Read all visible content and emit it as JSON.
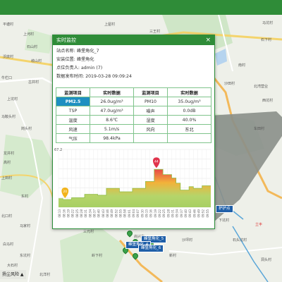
{
  "dialog": {
    "title": "实时监控",
    "close_glyph": "×",
    "info": [
      {
        "label": "站点名称:",
        "value": "峰堡角化_7"
      },
      {
        "label": "安装位置:",
        "value": "峰堡角化"
      },
      {
        "label": "点位负责人:",
        "value": "admin (7)"
      },
      {
        "label": "数据发布时间:",
        "value": "2019-03-28 09:09:24"
      }
    ],
    "table_headers": [
      "监测项目",
      "实时数据",
      "监测项目",
      "实时数据"
    ],
    "rows": [
      [
        "PM2.5",
        "26.0ug/m³",
        "PM10",
        "35.0ug/m³"
      ],
      [
        "TSP",
        "47.0ug/m³",
        "噪声",
        "0.0dB"
      ],
      [
        "温度",
        "8.6℃",
        "湿度",
        "40.0%"
      ],
      [
        "风速",
        "5.1m/s",
        "风向",
        "东北"
      ],
      [
        "气压",
        "98.4kPa",
        "",
        ""
      ]
    ]
  },
  "chart_data": {
    "type": "area",
    "ylim": [
      0,
      67.2
    ],
    "y_max_label": "67.2",
    "x": [
      "08:13",
      "08:16",
      "08:19",
      "08:22",
      "08:25",
      "08:28",
      "08:31",
      "08:34",
      "08:37",
      "08:40",
      "08:43",
      "08:46",
      "08:49",
      "08:52",
      "08:55",
      "08:58",
      "09:01",
      "09:04",
      "09:07",
      "09:10",
      "09:13",
      "09:16",
      "09:19",
      "09:22",
      "09:25",
      "09:28",
      "09:31",
      "09:34",
      "09:37",
      "09:40",
      "09:43",
      "09:46",
      "09:49",
      "09:52",
      "09:55"
    ],
    "values": [
      10,
      9,
      9,
      11,
      11,
      11,
      15,
      15,
      15,
      14,
      14,
      22,
      22,
      22,
      18,
      18,
      18,
      22,
      22,
      22,
      30,
      30,
      44,
      44,
      38,
      38,
      34,
      28,
      20,
      20,
      24,
      22,
      22,
      25,
      25
    ],
    "markers": [
      {
        "index": 1,
        "label": "20",
        "color": "#f2b31a"
      },
      {
        "index": 22,
        "label": "44",
        "color": "#e0324b"
      }
    ]
  },
  "map": {
    "labels": [
      {
        "text": "平塘村",
        "cls": ""
      },
      {
        "text": "上河村",
        "cls": ""
      },
      {
        "text": "石山村",
        "cls": ""
      },
      {
        "text": "沃底村",
        "cls": ""
      },
      {
        "text": "岐山村",
        "cls": ""
      },
      {
        "text": "牛栏口",
        "cls": ""
      },
      {
        "text": "古井村",
        "cls": ""
      },
      {
        "text": "上坑村",
        "cls": ""
      },
      {
        "text": "马鞍头村",
        "cls": ""
      },
      {
        "text": "岗头村",
        "cls": ""
      },
      {
        "text": "龙井村",
        "cls": ""
      },
      {
        "text": "高村",
        "cls": ""
      },
      {
        "text": "上田村",
        "cls": ""
      },
      {
        "text": "东村",
        "cls": ""
      },
      {
        "text": "北口村",
        "cls": ""
      },
      {
        "text": "马家村",
        "cls": ""
      },
      {
        "text": "白马村",
        "cls": ""
      },
      {
        "text": "东坑村",
        "cls": ""
      },
      {
        "text": "大石村",
        "cls": ""
      },
      {
        "text": "上屋村",
        "cls": ""
      },
      {
        "text": "三王村",
        "cls": ""
      },
      {
        "text": "马坑村",
        "cls": ""
      },
      {
        "text": "石下村",
        "cls": ""
      },
      {
        "text": "南村",
        "cls": ""
      },
      {
        "text": "北湾营业",
        "cls": ""
      },
      {
        "text": "西坑村",
        "cls": ""
      },
      {
        "text": "沙田村",
        "cls": ""
      },
      {
        "text": "车田村",
        "cls": ""
      },
      {
        "text": "下坑村",
        "cls": ""
      },
      {
        "text": "石头坑村",
        "cls": ""
      },
      {
        "text": "立丰",
        "cls": "red"
      },
      {
        "text": "尚兴东",
        "cls": ""
      },
      {
        "text": "三元村",
        "cls": ""
      },
      {
        "text": "沙坪村",
        "cls": ""
      },
      {
        "text": "岭下村",
        "cls": ""
      },
      {
        "text": "新村",
        "cls": ""
      },
      {
        "text": "洞头村",
        "cls": ""
      },
      {
        "text": "北洋村",
        "cls": ""
      }
    ],
    "sites": [
      "峰堡角化_5",
      "峰堡角化_4",
      "峰堡角化_6"
    ],
    "extra_site": "护护点",
    "bottom_left_text": "扬尘风险 ▲"
  },
  "colors": {
    "primary": "#2f8c38",
    "selected_cell": "#1f8fc1",
    "chart_fill_low": "#b5d56a",
    "chart_fill_high": "#e94848"
  }
}
